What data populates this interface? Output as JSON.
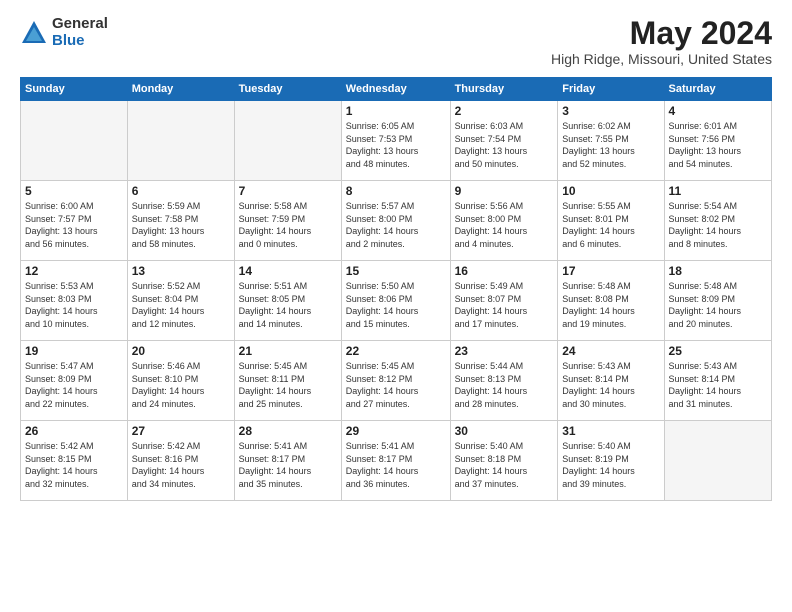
{
  "logo": {
    "general": "General",
    "blue": "Blue"
  },
  "title": "May 2024",
  "location": "High Ridge, Missouri, United States",
  "days_of_week": [
    "Sunday",
    "Monday",
    "Tuesday",
    "Wednesday",
    "Thursday",
    "Friday",
    "Saturday"
  ],
  "weeks": [
    [
      {
        "num": "",
        "info": ""
      },
      {
        "num": "",
        "info": ""
      },
      {
        "num": "",
        "info": ""
      },
      {
        "num": "1",
        "info": "Sunrise: 6:05 AM\nSunset: 7:53 PM\nDaylight: 13 hours\nand 48 minutes."
      },
      {
        "num": "2",
        "info": "Sunrise: 6:03 AM\nSunset: 7:54 PM\nDaylight: 13 hours\nand 50 minutes."
      },
      {
        "num": "3",
        "info": "Sunrise: 6:02 AM\nSunset: 7:55 PM\nDaylight: 13 hours\nand 52 minutes."
      },
      {
        "num": "4",
        "info": "Sunrise: 6:01 AM\nSunset: 7:56 PM\nDaylight: 13 hours\nand 54 minutes."
      }
    ],
    [
      {
        "num": "5",
        "info": "Sunrise: 6:00 AM\nSunset: 7:57 PM\nDaylight: 13 hours\nand 56 minutes."
      },
      {
        "num": "6",
        "info": "Sunrise: 5:59 AM\nSunset: 7:58 PM\nDaylight: 13 hours\nand 58 minutes."
      },
      {
        "num": "7",
        "info": "Sunrise: 5:58 AM\nSunset: 7:59 PM\nDaylight: 14 hours\nand 0 minutes."
      },
      {
        "num": "8",
        "info": "Sunrise: 5:57 AM\nSunset: 8:00 PM\nDaylight: 14 hours\nand 2 minutes."
      },
      {
        "num": "9",
        "info": "Sunrise: 5:56 AM\nSunset: 8:00 PM\nDaylight: 14 hours\nand 4 minutes."
      },
      {
        "num": "10",
        "info": "Sunrise: 5:55 AM\nSunset: 8:01 PM\nDaylight: 14 hours\nand 6 minutes."
      },
      {
        "num": "11",
        "info": "Sunrise: 5:54 AM\nSunset: 8:02 PM\nDaylight: 14 hours\nand 8 minutes."
      }
    ],
    [
      {
        "num": "12",
        "info": "Sunrise: 5:53 AM\nSunset: 8:03 PM\nDaylight: 14 hours\nand 10 minutes."
      },
      {
        "num": "13",
        "info": "Sunrise: 5:52 AM\nSunset: 8:04 PM\nDaylight: 14 hours\nand 12 minutes."
      },
      {
        "num": "14",
        "info": "Sunrise: 5:51 AM\nSunset: 8:05 PM\nDaylight: 14 hours\nand 14 minutes."
      },
      {
        "num": "15",
        "info": "Sunrise: 5:50 AM\nSunset: 8:06 PM\nDaylight: 14 hours\nand 15 minutes."
      },
      {
        "num": "16",
        "info": "Sunrise: 5:49 AM\nSunset: 8:07 PM\nDaylight: 14 hours\nand 17 minutes."
      },
      {
        "num": "17",
        "info": "Sunrise: 5:48 AM\nSunset: 8:08 PM\nDaylight: 14 hours\nand 19 minutes."
      },
      {
        "num": "18",
        "info": "Sunrise: 5:48 AM\nSunset: 8:09 PM\nDaylight: 14 hours\nand 20 minutes."
      }
    ],
    [
      {
        "num": "19",
        "info": "Sunrise: 5:47 AM\nSunset: 8:09 PM\nDaylight: 14 hours\nand 22 minutes."
      },
      {
        "num": "20",
        "info": "Sunrise: 5:46 AM\nSunset: 8:10 PM\nDaylight: 14 hours\nand 24 minutes."
      },
      {
        "num": "21",
        "info": "Sunrise: 5:45 AM\nSunset: 8:11 PM\nDaylight: 14 hours\nand 25 minutes."
      },
      {
        "num": "22",
        "info": "Sunrise: 5:45 AM\nSunset: 8:12 PM\nDaylight: 14 hours\nand 27 minutes."
      },
      {
        "num": "23",
        "info": "Sunrise: 5:44 AM\nSunset: 8:13 PM\nDaylight: 14 hours\nand 28 minutes."
      },
      {
        "num": "24",
        "info": "Sunrise: 5:43 AM\nSunset: 8:14 PM\nDaylight: 14 hours\nand 30 minutes."
      },
      {
        "num": "25",
        "info": "Sunrise: 5:43 AM\nSunset: 8:14 PM\nDaylight: 14 hours\nand 31 minutes."
      }
    ],
    [
      {
        "num": "26",
        "info": "Sunrise: 5:42 AM\nSunset: 8:15 PM\nDaylight: 14 hours\nand 32 minutes."
      },
      {
        "num": "27",
        "info": "Sunrise: 5:42 AM\nSunset: 8:16 PM\nDaylight: 14 hours\nand 34 minutes."
      },
      {
        "num": "28",
        "info": "Sunrise: 5:41 AM\nSunset: 8:17 PM\nDaylight: 14 hours\nand 35 minutes."
      },
      {
        "num": "29",
        "info": "Sunrise: 5:41 AM\nSunset: 8:17 PM\nDaylight: 14 hours\nand 36 minutes."
      },
      {
        "num": "30",
        "info": "Sunrise: 5:40 AM\nSunset: 8:18 PM\nDaylight: 14 hours\nand 37 minutes."
      },
      {
        "num": "31",
        "info": "Sunrise: 5:40 AM\nSunset: 8:19 PM\nDaylight: 14 hours\nand 39 minutes."
      },
      {
        "num": "",
        "info": ""
      }
    ]
  ]
}
